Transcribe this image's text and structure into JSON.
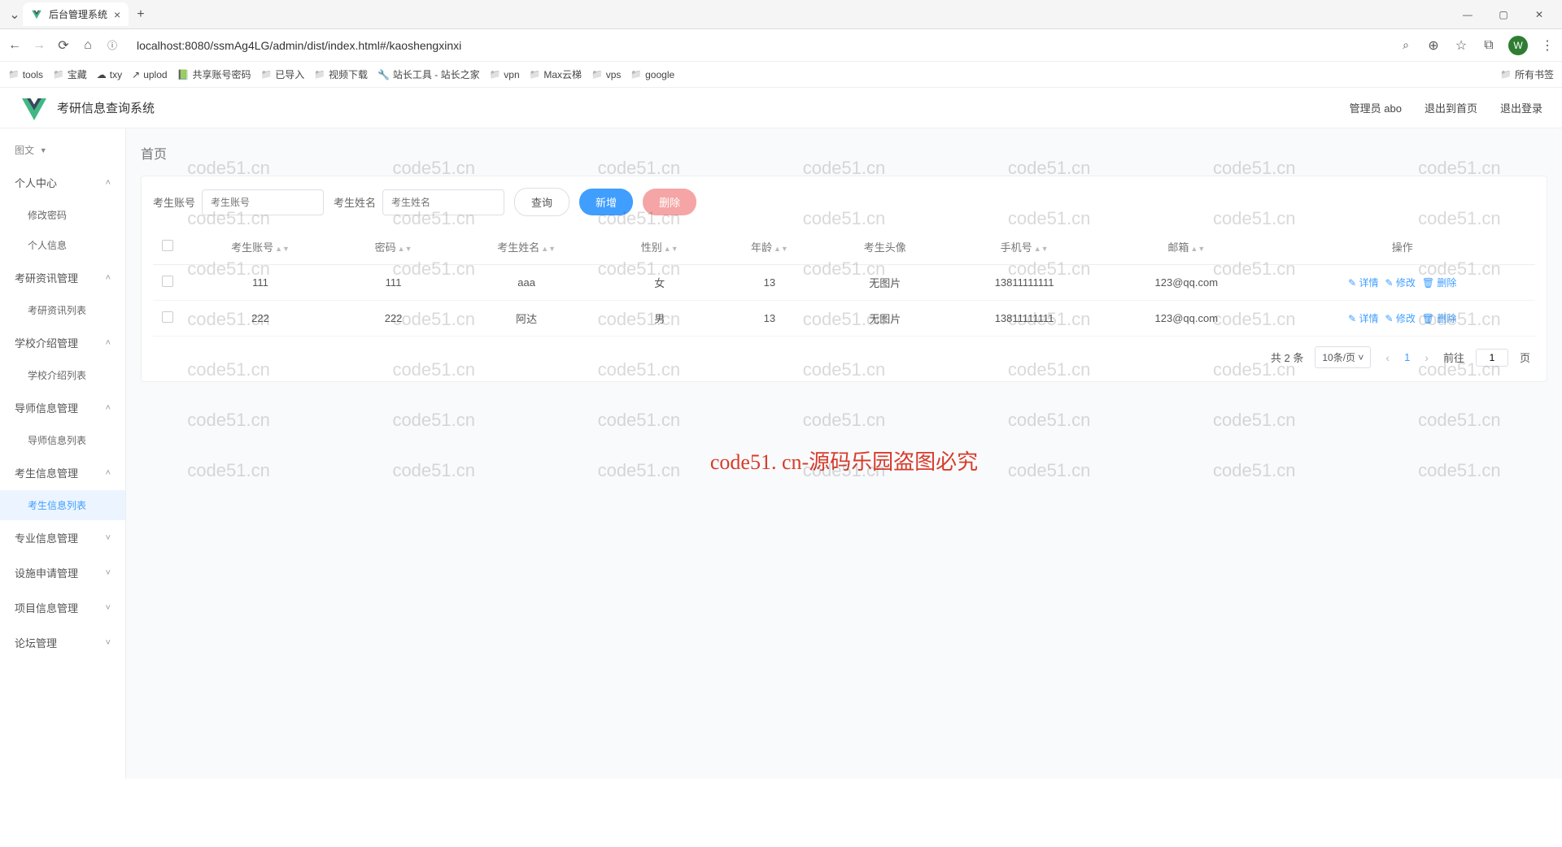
{
  "browser": {
    "tab_title": "后台管理系统",
    "url": "localhost:8080/ssmAg4LG/admin/dist/index.html#/kaoshengxinxi",
    "bookmarks": [
      "tools",
      "宝藏",
      "txy",
      "uplod",
      "共享账号密码",
      "已导入",
      "视频下载",
      "站长工具 - 站长之家",
      "vpn",
      "Max云梯",
      "vps",
      "google"
    ],
    "all_bookmarks": "所有书签",
    "avatar_initial": "W"
  },
  "header": {
    "app_name": "考研信息查询系统",
    "user_label": "管理员 abo",
    "link_home": "退出到首页",
    "link_logout": "退出登录"
  },
  "sidebar": {
    "title": "图文",
    "groups": [
      {
        "label": "个人中心",
        "items": [
          "修改密码",
          "个人信息"
        ],
        "open": true
      },
      {
        "label": "考研资讯管理",
        "items": [
          "考研资讯列表"
        ],
        "open": true
      },
      {
        "label": "学校介绍管理",
        "items": [
          "学校介绍列表"
        ],
        "open": true
      },
      {
        "label": "导师信息管理",
        "items": [
          "导师信息列表"
        ],
        "open": true
      },
      {
        "label": "考生信息管理",
        "items": [
          "考生信息列表"
        ],
        "open": true,
        "active_item": 0
      },
      {
        "label": "专业信息管理",
        "items": [],
        "open": false
      },
      {
        "label": "设施申请管理",
        "items": [],
        "open": false
      },
      {
        "label": "项目信息管理",
        "items": [],
        "open": false
      },
      {
        "label": "论坛管理",
        "items": [],
        "open": false
      }
    ]
  },
  "main": {
    "breadcrumb": "首页",
    "filters": {
      "account": {
        "label": "考生账号",
        "placeholder": "考生账号"
      },
      "name": {
        "label": "考生姓名",
        "placeholder": "考生姓名"
      },
      "btn_query": "查询",
      "btn_add": "新增",
      "btn_delete": "删除"
    },
    "table": {
      "columns": [
        "考生账号",
        "密码",
        "考生姓名",
        "性别",
        "年龄",
        "考生头像",
        "手机号",
        "邮箱",
        "操作"
      ],
      "rows": [
        {
          "account": "111",
          "password": "111",
          "name": "aaa",
          "gender": "女",
          "age": "13",
          "avatar": "无图片",
          "phone": "13811111111",
          "email": "123@qq.com"
        },
        {
          "account": "222",
          "password": "222",
          "name": "阿达",
          "gender": "男",
          "age": "13",
          "avatar": "无图片",
          "phone": "13811111111",
          "email": "123@qq.com"
        }
      ],
      "ops": {
        "detail": "详情",
        "edit": "修改",
        "delete": "删除"
      }
    },
    "pagination": {
      "total_label": "共 2 条",
      "page_size": "10条/页",
      "current": "1",
      "goto_label": "前往",
      "goto_value": "1",
      "page_suffix": "页"
    }
  },
  "watermark": {
    "text": "code51.cn",
    "center": "code51. cn-源码乐园盗图必究"
  }
}
